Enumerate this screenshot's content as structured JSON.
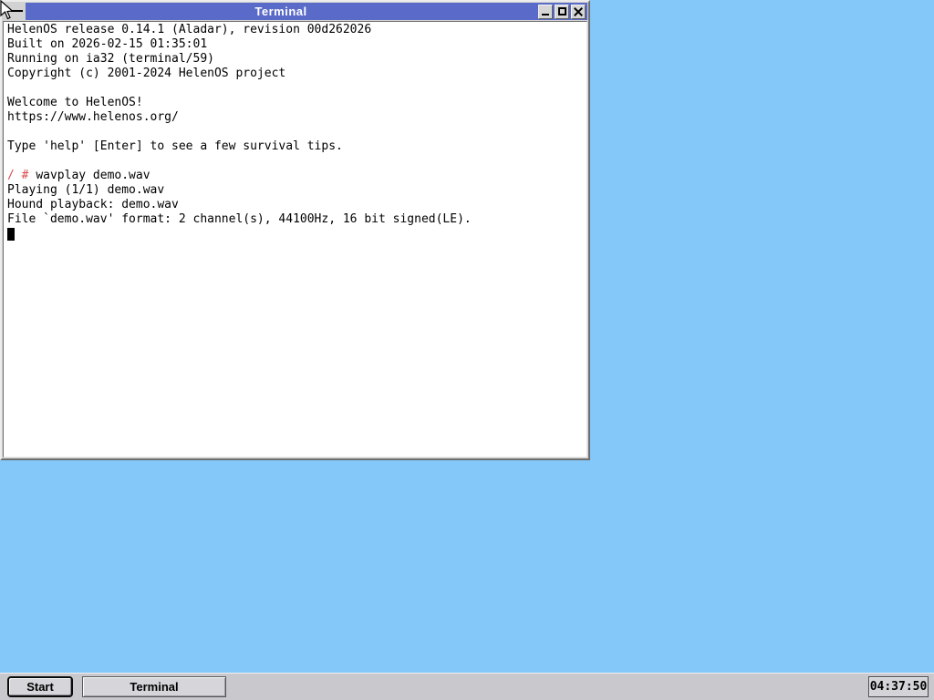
{
  "desktop": {
    "background": "#84c8fa"
  },
  "window": {
    "title": "Terminal",
    "colors": {
      "titlebar": "#5a6ac8",
      "frame": "#d2d2d2",
      "terminal_bg": "#ffffff",
      "terminal_text": "#000000",
      "prompt_red": "#d94f4f"
    },
    "icons": {
      "sysmenu": "dash-icon",
      "minimize": "minimize-icon",
      "maximize": "maximize-icon",
      "close": "close-icon"
    }
  },
  "terminal": {
    "lines": [
      {
        "segments": [
          {
            "text": "HelenOS release 0.14.1 (Aladar), revision 00d262026",
            "style": "normal"
          }
        ]
      },
      {
        "segments": [
          {
            "text": "Built on 2026-02-15 01:35:01",
            "style": "normal"
          }
        ]
      },
      {
        "segments": [
          {
            "text": "Running on ia32 (terminal/59)",
            "style": "normal"
          }
        ]
      },
      {
        "segments": [
          {
            "text": "Copyright (c) 2001-2024 HelenOS project",
            "style": "normal"
          }
        ]
      },
      {
        "segments": []
      },
      {
        "segments": [
          {
            "text": "Welcome to HelenOS!",
            "style": "normal"
          }
        ]
      },
      {
        "segments": [
          {
            "text": "https://www.helenos.org/",
            "style": "normal"
          }
        ]
      },
      {
        "segments": []
      },
      {
        "segments": [
          {
            "text": "Type 'help' [Enter] to see a few survival tips.",
            "style": "normal"
          }
        ]
      },
      {
        "segments": []
      },
      {
        "segments": [
          {
            "text": "/ # ",
            "style": "prompt"
          },
          {
            "text": "wavplay demo.wav",
            "style": "normal"
          }
        ]
      },
      {
        "segments": [
          {
            "text": "Playing (1/1) demo.wav",
            "style": "normal"
          }
        ]
      },
      {
        "segments": [
          {
            "text": "Hound playback: demo.wav",
            "style": "normal"
          }
        ]
      },
      {
        "segments": [
          {
            "text": "File `demo.wav' format: 2 channel(s), 44100Hz, 16 bit signed(LE).",
            "style": "normal"
          }
        ]
      },
      {
        "segments": [],
        "cursor": true
      }
    ]
  },
  "taskbar": {
    "start_label": "Start",
    "tasks": [
      {
        "label": "Terminal"
      }
    ],
    "clock": "04:37:50"
  }
}
